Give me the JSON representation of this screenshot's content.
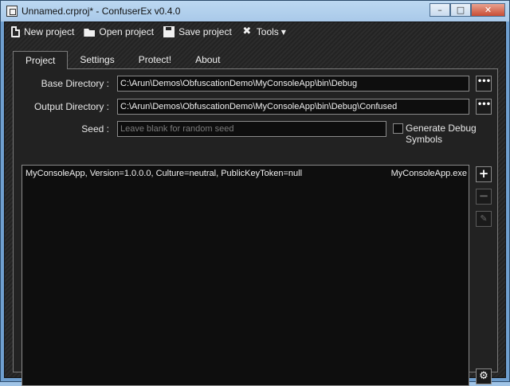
{
  "window": {
    "title": "Unnamed.crproj* - ConfuserEx v0.4.0",
    "controls": {
      "minimize": "–",
      "maximize": "□",
      "close": "✕"
    }
  },
  "toolbar": {
    "new_project": "New project",
    "open_project": "Open project",
    "save_project": "Save project",
    "tools": "Tools"
  },
  "tabs": [
    {
      "label": "Project",
      "active": true
    },
    {
      "label": "Settings",
      "active": false
    },
    {
      "label": "Protect!",
      "active": false
    },
    {
      "label": "About",
      "active": false
    }
  ],
  "project": {
    "base_dir_label": "Base Directory :",
    "base_dir_value": "C:\\Arun\\Demos\\ObfuscationDemo\\MyConsoleApp\\bin\\Debug",
    "output_dir_label": "Output Directory :",
    "output_dir_value": "C:\\Arun\\Demos\\ObfuscationDemo\\MyConsoleApp\\bin\\Debug\\Confused",
    "seed_label": "Seed :",
    "seed_placeholder": "Leave blank for random seed",
    "debug_symbols_label": "Generate Debug Symbols",
    "debug_symbols_checked": false,
    "browse_label": "•••",
    "modules": [
      {
        "name": "MyConsoleApp, Version=1.0.0.0, Culture=neutral, PublicKeyToken=null",
        "file": "MyConsoleApp.exe"
      }
    ],
    "buttons": {
      "add": "+",
      "remove": "−",
      "edit": "✎",
      "settings": "⚙"
    }
  },
  "colors": {
    "background": "#262626",
    "field_bg": "#0e0e0e",
    "border": "#8a8a8a",
    "text": "#f0f0f0"
  }
}
